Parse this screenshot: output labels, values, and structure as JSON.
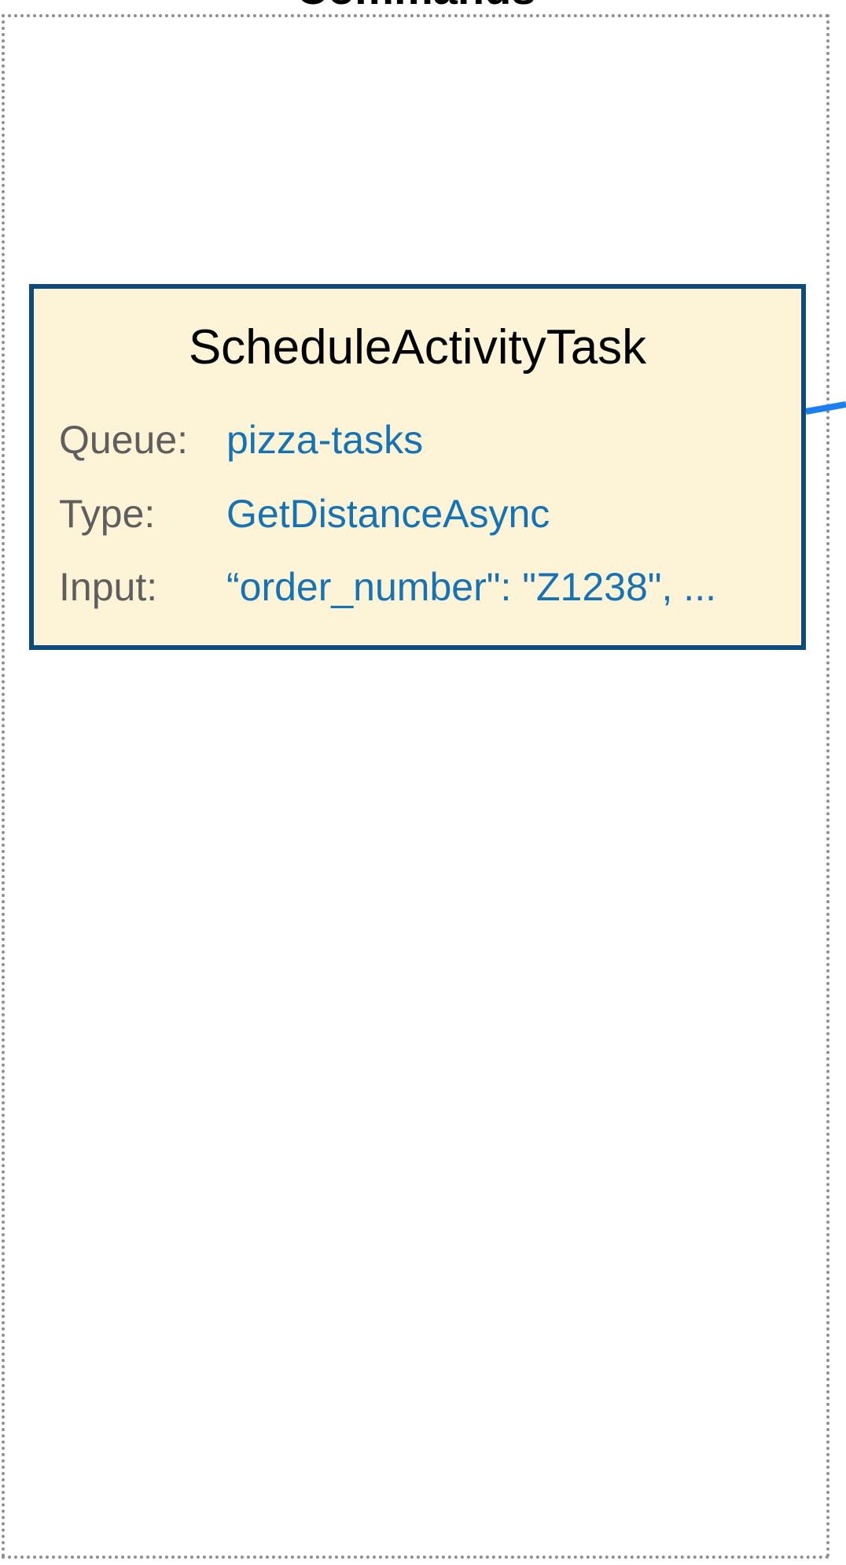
{
  "container": {
    "title": "Commands"
  },
  "task": {
    "title": "ScheduleActivityTask",
    "fields": [
      {
        "label": "Queue:",
        "value": "pizza-tasks"
      },
      {
        "label": "Type:",
        "value": "GetDistanceAsync"
      },
      {
        "label": "Input:",
        "value": "“order_number\": \"Z1238\", ..."
      }
    ]
  },
  "colors": {
    "card_background": "#fdf3d6",
    "card_border": "#0d4b7f",
    "label_text": "#5e5e5e",
    "value_text": "#1573b5",
    "connector": "#1a7ff2",
    "container_border": "#8f8f8f"
  }
}
